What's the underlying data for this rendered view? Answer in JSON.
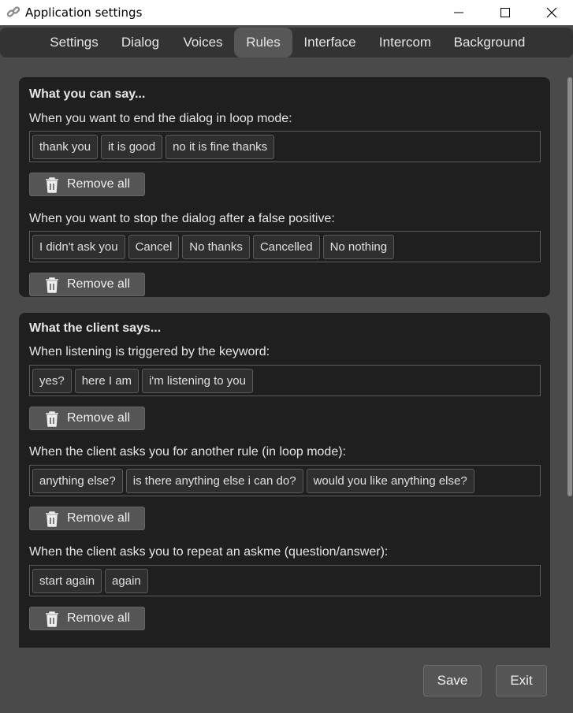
{
  "window": {
    "title": "Application settings",
    "controls": {
      "minimize": "minimize",
      "maximize": "maximize",
      "close": "close"
    }
  },
  "tabs": [
    {
      "label": "Settings",
      "active": false
    },
    {
      "label": "Dialog",
      "active": false
    },
    {
      "label": "Voices",
      "active": false
    },
    {
      "label": "Rules",
      "active": true
    },
    {
      "label": "Interface",
      "active": false
    },
    {
      "label": "Intercom",
      "active": false
    },
    {
      "label": "Background",
      "active": false
    }
  ],
  "sections": [
    {
      "title": "What you can say...",
      "rules": [
        {
          "label": "When you want to end the dialog in loop mode:",
          "chips": [
            "thank you",
            "it is good",
            "no it is fine thanks"
          ],
          "remove_label": "Remove all"
        },
        {
          "label": "When you want to stop the dialog after a false positive:",
          "chips": [
            "I didn't ask you",
            "Cancel",
            "No thanks",
            "Cancelled",
            "No nothing"
          ],
          "remove_label": "Remove all"
        }
      ]
    },
    {
      "title": "What the client says...",
      "rules": [
        {
          "label": "When listening is triggered by the keyword:",
          "chips": [
            "yes?",
            "here I am",
            "i'm listening to you"
          ],
          "remove_label": "Remove all"
        },
        {
          "label": "When the client asks you for another rule (in loop mode):",
          "chips": [
            "anything else?",
            "is there anything else i can do?",
            "would you like anything else?"
          ],
          "remove_label": "Remove all"
        },
        {
          "label": "When the client asks you to repeat an askme (question/answer):",
          "chips": [
            "start again",
            "again"
          ],
          "remove_label": "Remove all"
        }
      ]
    }
  ],
  "footer": {
    "save_label": "Save",
    "exit_label": "Exit"
  },
  "colors": {
    "window_bg": "#4a4a4a",
    "card_bg": "#1f1f1f",
    "tab_bar": "#333333",
    "active_tab": "#575757",
    "button_bg": "#555555"
  }
}
